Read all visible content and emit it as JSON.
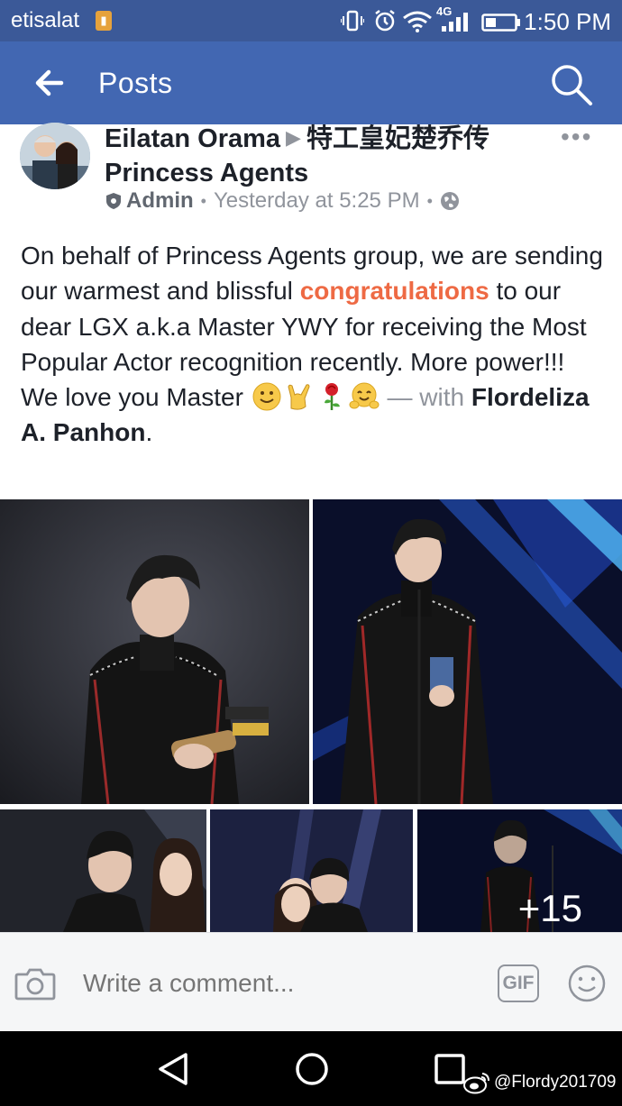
{
  "status_bar": {
    "carrier": "etisalat",
    "network": "4G",
    "time": "1:50 PM"
  },
  "app_bar": {
    "title": "Posts",
    "back_icon": "arrow-left-icon",
    "search_icon": "search-icon"
  },
  "post": {
    "author": "Eilatan Orama",
    "group_name_cn": "特工皇妃楚乔传",
    "group_name": "Princess Agents",
    "role": "Admin",
    "timestamp": "Yesterday at 5:25 PM",
    "text_part1": "On behalf of Princess Agents group, we are sending our warmest and blissful ",
    "text_highlight": "congratulations",
    "text_part2": " to our dear LGX a.k.a Master YWY for receiving the Most Popular Actor recognition recently. More power!!! We love you Master ",
    "with_label": " — with ",
    "tagged_person": "Flordeliza A. Panhon",
    "end_punct": ".",
    "more_photos": "+15"
  },
  "comment_bar": {
    "placeholder": "Write a comment...",
    "gif_label": "GIF"
  },
  "watermark": "@Flordy201709",
  "colors": {
    "brand": "#4267b2",
    "status_bar": "#3b5998",
    "highlight": "#ee6a44",
    "meta_text": "#90949c"
  }
}
